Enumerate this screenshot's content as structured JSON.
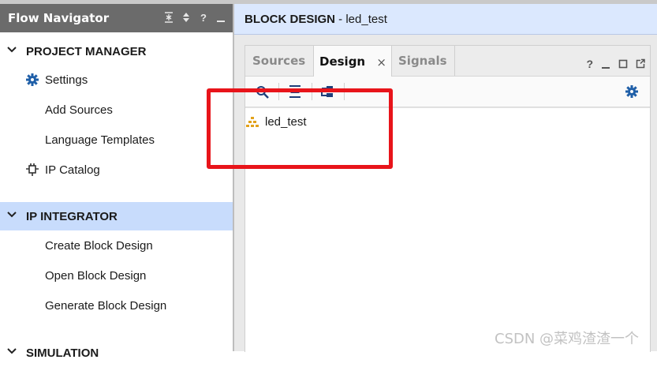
{
  "flow_navigator": {
    "title": "Flow Navigator",
    "header_icons": [
      "collapse-all-icon",
      "sort-icon",
      "help-icon",
      "minimize-icon"
    ],
    "sections": [
      {
        "label": "PROJECT MANAGER",
        "items": [
          {
            "label": "Settings",
            "icon": "gear-icon"
          },
          {
            "label": "Add Sources"
          },
          {
            "label": "Language Templates"
          },
          {
            "label": "IP Catalog",
            "icon": "plug-icon"
          }
        ]
      },
      {
        "label": "IP INTEGRATOR",
        "selected": true,
        "items": [
          {
            "label": "Create Block Design"
          },
          {
            "label": "Open Block Design"
          },
          {
            "label": "Generate Block Design"
          }
        ]
      },
      {
        "label": "SIMULATION"
      }
    ]
  },
  "block_design": {
    "title_prefix": "BLOCK DESIGN",
    "title_suffix": " - led_test"
  },
  "panel": {
    "tabs": [
      {
        "label": "Sources",
        "active": false
      },
      {
        "label": "Design",
        "active": true,
        "close": "×"
      },
      {
        "label": "Signals",
        "active": false
      }
    ],
    "window_icons": [
      "help-icon",
      "minimize-icon",
      "maximize-icon",
      "float-icon"
    ],
    "toolbar_icons": [
      "search-icon",
      "collapse-all-icon",
      "expand-all-icon",
      "settings-gear-icon"
    ],
    "tree": [
      {
        "label": "led_test",
        "icon": "hierarchy-icon"
      }
    ]
  },
  "watermark": "CSDN @菜鸡渣渣一个",
  "colors": {
    "nav_header_bg": "#6b6b6b",
    "selected_row_bg": "#c8dcfc",
    "design_header_bg": "#dbe8fe",
    "accent_blue": "#1f5fa8",
    "highlight_red": "#e8141a"
  }
}
